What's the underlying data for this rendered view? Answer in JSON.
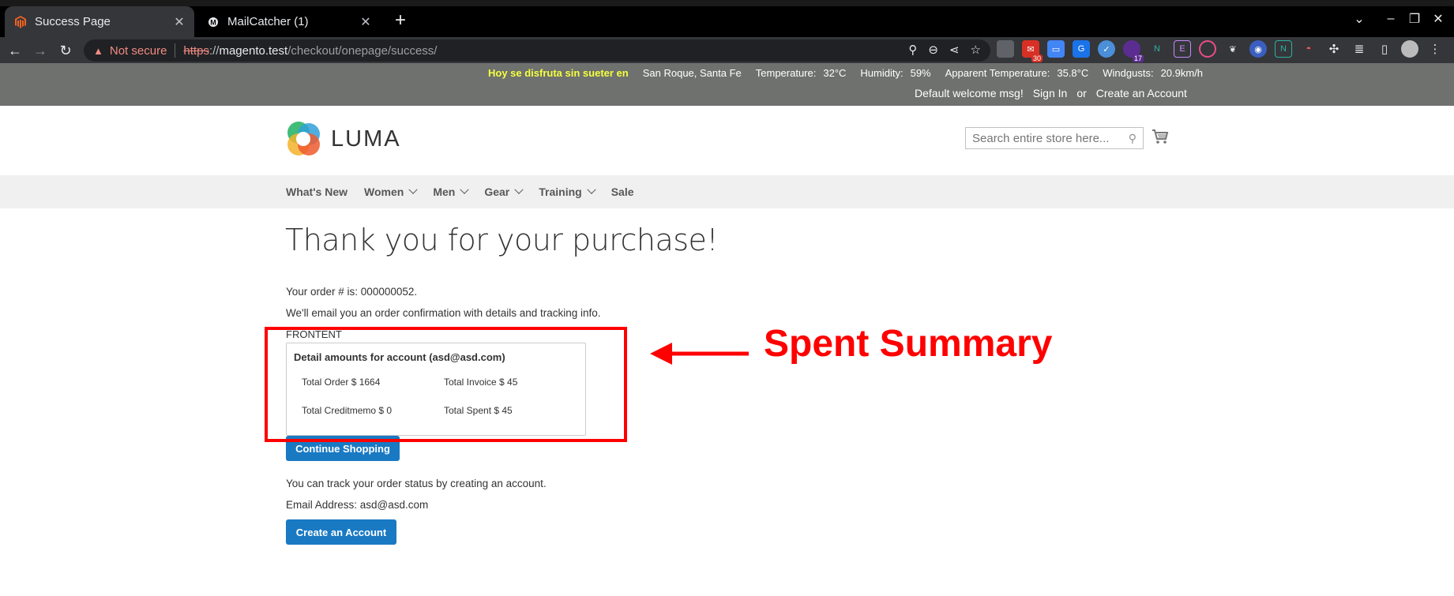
{
  "browser": {
    "tabs": [
      {
        "title": "Success Page",
        "icon": "magento-icon"
      },
      {
        "title": "MailCatcher (1)",
        "icon": "mailcatcher-icon"
      }
    ],
    "address": {
      "security_label": "Not secure",
      "scheme": "https",
      "scheme_sep": "://",
      "host": "magento.test",
      "path": "/checkout/onepage/success/"
    },
    "extension_badges": {
      "gmail": "30",
      "purple": "17"
    }
  },
  "store_top": {
    "slogan": "Hoy se disfruta sin sueter en",
    "location": "San Roque, Santa Fe",
    "temperature_label": "Temperature:",
    "temperature_value": "32°C",
    "humidity_label": "Humidity:",
    "humidity_value": "59%",
    "apparent_label": "Apparent Temperature:",
    "apparent_value": "35.8°C",
    "windgusts_label": "Windgusts:",
    "windgusts_value": "20.9km/h",
    "welcome": "Default welcome msg!",
    "sign_in": "Sign In",
    "or": "or",
    "create_account": "Create an Account"
  },
  "header": {
    "logo_text": "LUMA",
    "search_placeholder": "Search entire store here..."
  },
  "nav": {
    "items": [
      {
        "label": "What's New",
        "dropdown": false
      },
      {
        "label": "Women",
        "dropdown": true
      },
      {
        "label": "Men",
        "dropdown": true
      },
      {
        "label": "Gear",
        "dropdown": true
      },
      {
        "label": "Training",
        "dropdown": true
      },
      {
        "label": "Sale",
        "dropdown": false
      }
    ]
  },
  "main": {
    "title": "Thank you for your purchase!",
    "order_line": "Your order # is: 000000052.",
    "email_line": "We'll email you an order confirmation with details and tracking info.",
    "frontent_label": "FRONTENT",
    "detail": {
      "title": "Detail amounts for account (asd@asd.com)",
      "total_order": "Total Order $ 1664",
      "total_invoice": "Total Invoice $ 45",
      "total_creditmemo": "Total Creditmemo $ 0",
      "total_spent": "Total Spent $ 45"
    },
    "continue_button": "Continue Shopping",
    "track_line": "You can track your order status by creating an account.",
    "email_address_line": "Email Address: asd@asd.com",
    "create_button": "Create an Account"
  },
  "annotation": {
    "label": "Spent Summary",
    "color": "#ff0000"
  }
}
